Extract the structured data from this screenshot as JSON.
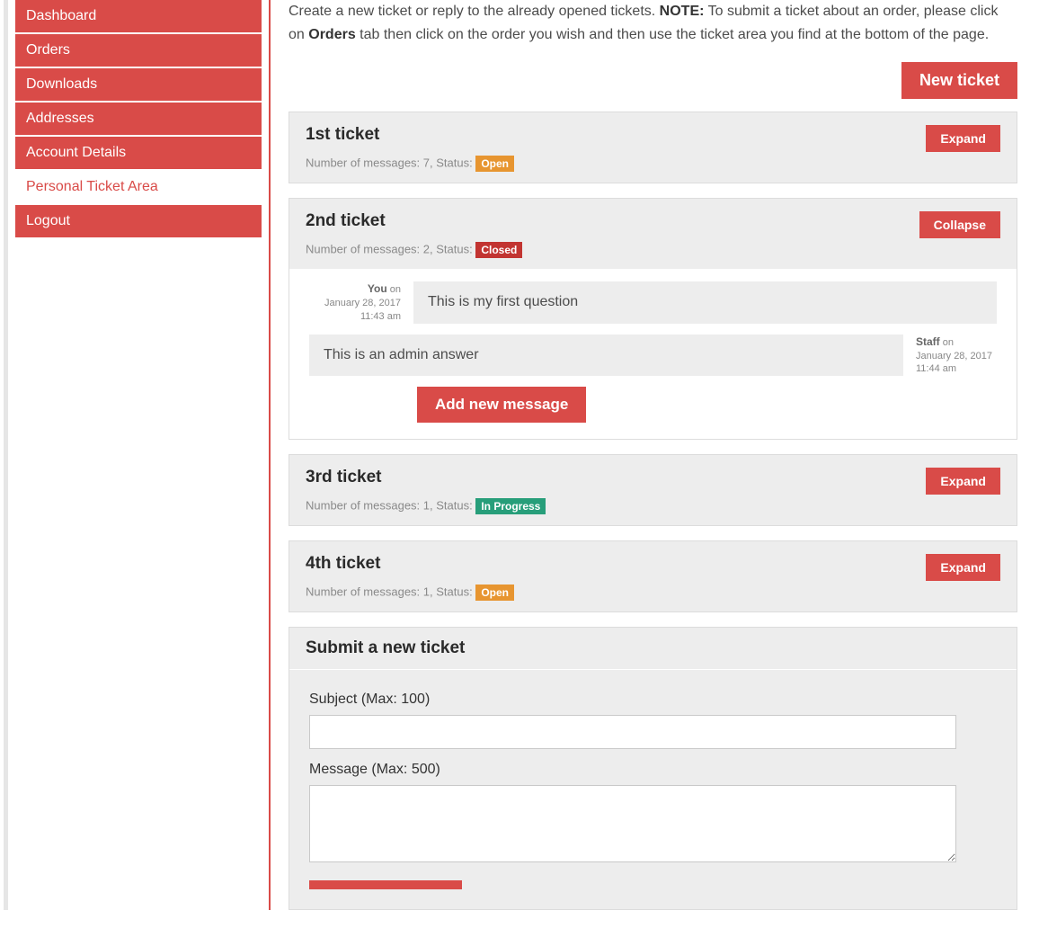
{
  "intro": {
    "pre": "Create a new ticket or reply to the already opened tickets. ",
    "note": "NOTE:",
    "mid": " To submit a ticket about an order, please click on ",
    "orders": "Orders",
    "post": " tab then click on the order you wish and then use the ticket area you find at the bottom of the page."
  },
  "nav": [
    {
      "label": "Dashboard"
    },
    {
      "label": "Orders"
    },
    {
      "label": "Downloads"
    },
    {
      "label": "Addresses"
    },
    {
      "label": "Account Details"
    },
    {
      "label": "Personal Ticket Area"
    },
    {
      "label": "Logout"
    }
  ],
  "buttons": {
    "new_ticket": "New ticket",
    "expand": "Expand",
    "collapse": "Collapse",
    "add_message": "Add new message"
  },
  "meta": {
    "prefix_messages": "Number of messages: ",
    "prefix_status": ", Status: "
  },
  "tickets": [
    {
      "title": "1st ticket",
      "count": "7",
      "status": "Open",
      "status_class": "badge-open",
      "action": "Expand",
      "expanded": false
    },
    {
      "title": "2nd ticket",
      "count": "2",
      "status": "Closed",
      "status_class": "badge-closed",
      "action": "Collapse",
      "expanded": true
    },
    {
      "title": "3rd ticket",
      "count": "1",
      "status": "In Progress",
      "status_class": "badge-progress",
      "action": "Expand",
      "expanded": false
    },
    {
      "title": "4th ticket",
      "count": "1",
      "status": "Open",
      "status_class": "badge-open",
      "action": "Expand",
      "expanded": false
    }
  ],
  "thread": {
    "user": {
      "who": "You",
      "on": "on",
      "date": "January 28, 2017",
      "time": "11:43 am",
      "text": "This is my first question"
    },
    "staff": {
      "who": "Staff",
      "on": "on",
      "date": "January 28, 2017",
      "time": "11:44 am",
      "text": "This is an admin answer"
    }
  },
  "form": {
    "title": "Submit a new ticket",
    "subject_label": "Subject (Max: 100)",
    "message_label": "Message (Max: 500)"
  }
}
